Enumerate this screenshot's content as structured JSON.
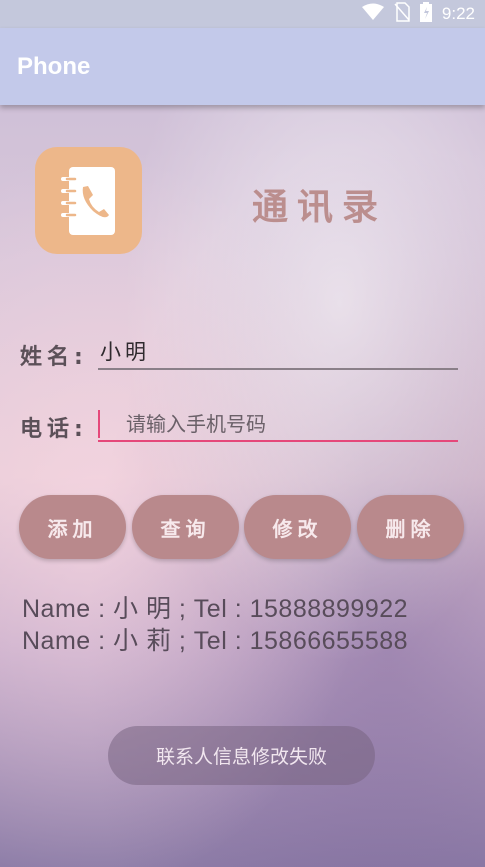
{
  "status_bar": {
    "time": "9:22",
    "icons": [
      "wifi-icon",
      "no-sim-icon",
      "battery-icon"
    ]
  },
  "app_bar": {
    "title": "Phone"
  },
  "header": {
    "title": "通讯录",
    "logo_icon": "contact-book-icon"
  },
  "form": {
    "name_label": "姓名:",
    "name_value": "小明",
    "phone_label": "电话:",
    "phone_placeholder": "请输入手机号码"
  },
  "buttons": {
    "add": "添加",
    "query": "查询",
    "edit": "修改",
    "delete": "删除"
  },
  "contacts": [
    "Name : 小 明 ; Tel : 15888899922",
    "Name : 小 莉 ; Tel : 15866655588"
  ],
  "toast": {
    "message": "联系人信息修改失败"
  },
  "colors": {
    "app_bar": "#c3c9ea",
    "logo_bg": "#edb78a",
    "button_bg": "#b9898c",
    "accent": "#e5487a"
  }
}
